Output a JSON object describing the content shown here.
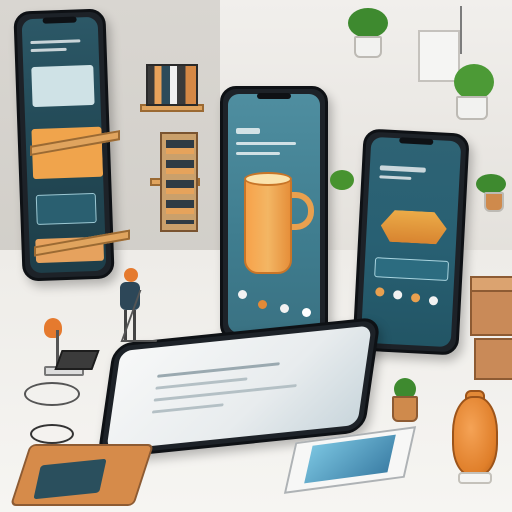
{
  "scene": {
    "phones": [
      {
        "name": "phone-left"
      },
      {
        "name": "phone-center-mug"
      },
      {
        "name": "phone-right-boat"
      },
      {
        "name": "phone-flat"
      }
    ],
    "colors": {
      "accent_orange": "#f3a24a",
      "screen_teal": "#3f7d8f",
      "wall": "#d9d6d1",
      "floor": "#eeece8"
    }
  }
}
